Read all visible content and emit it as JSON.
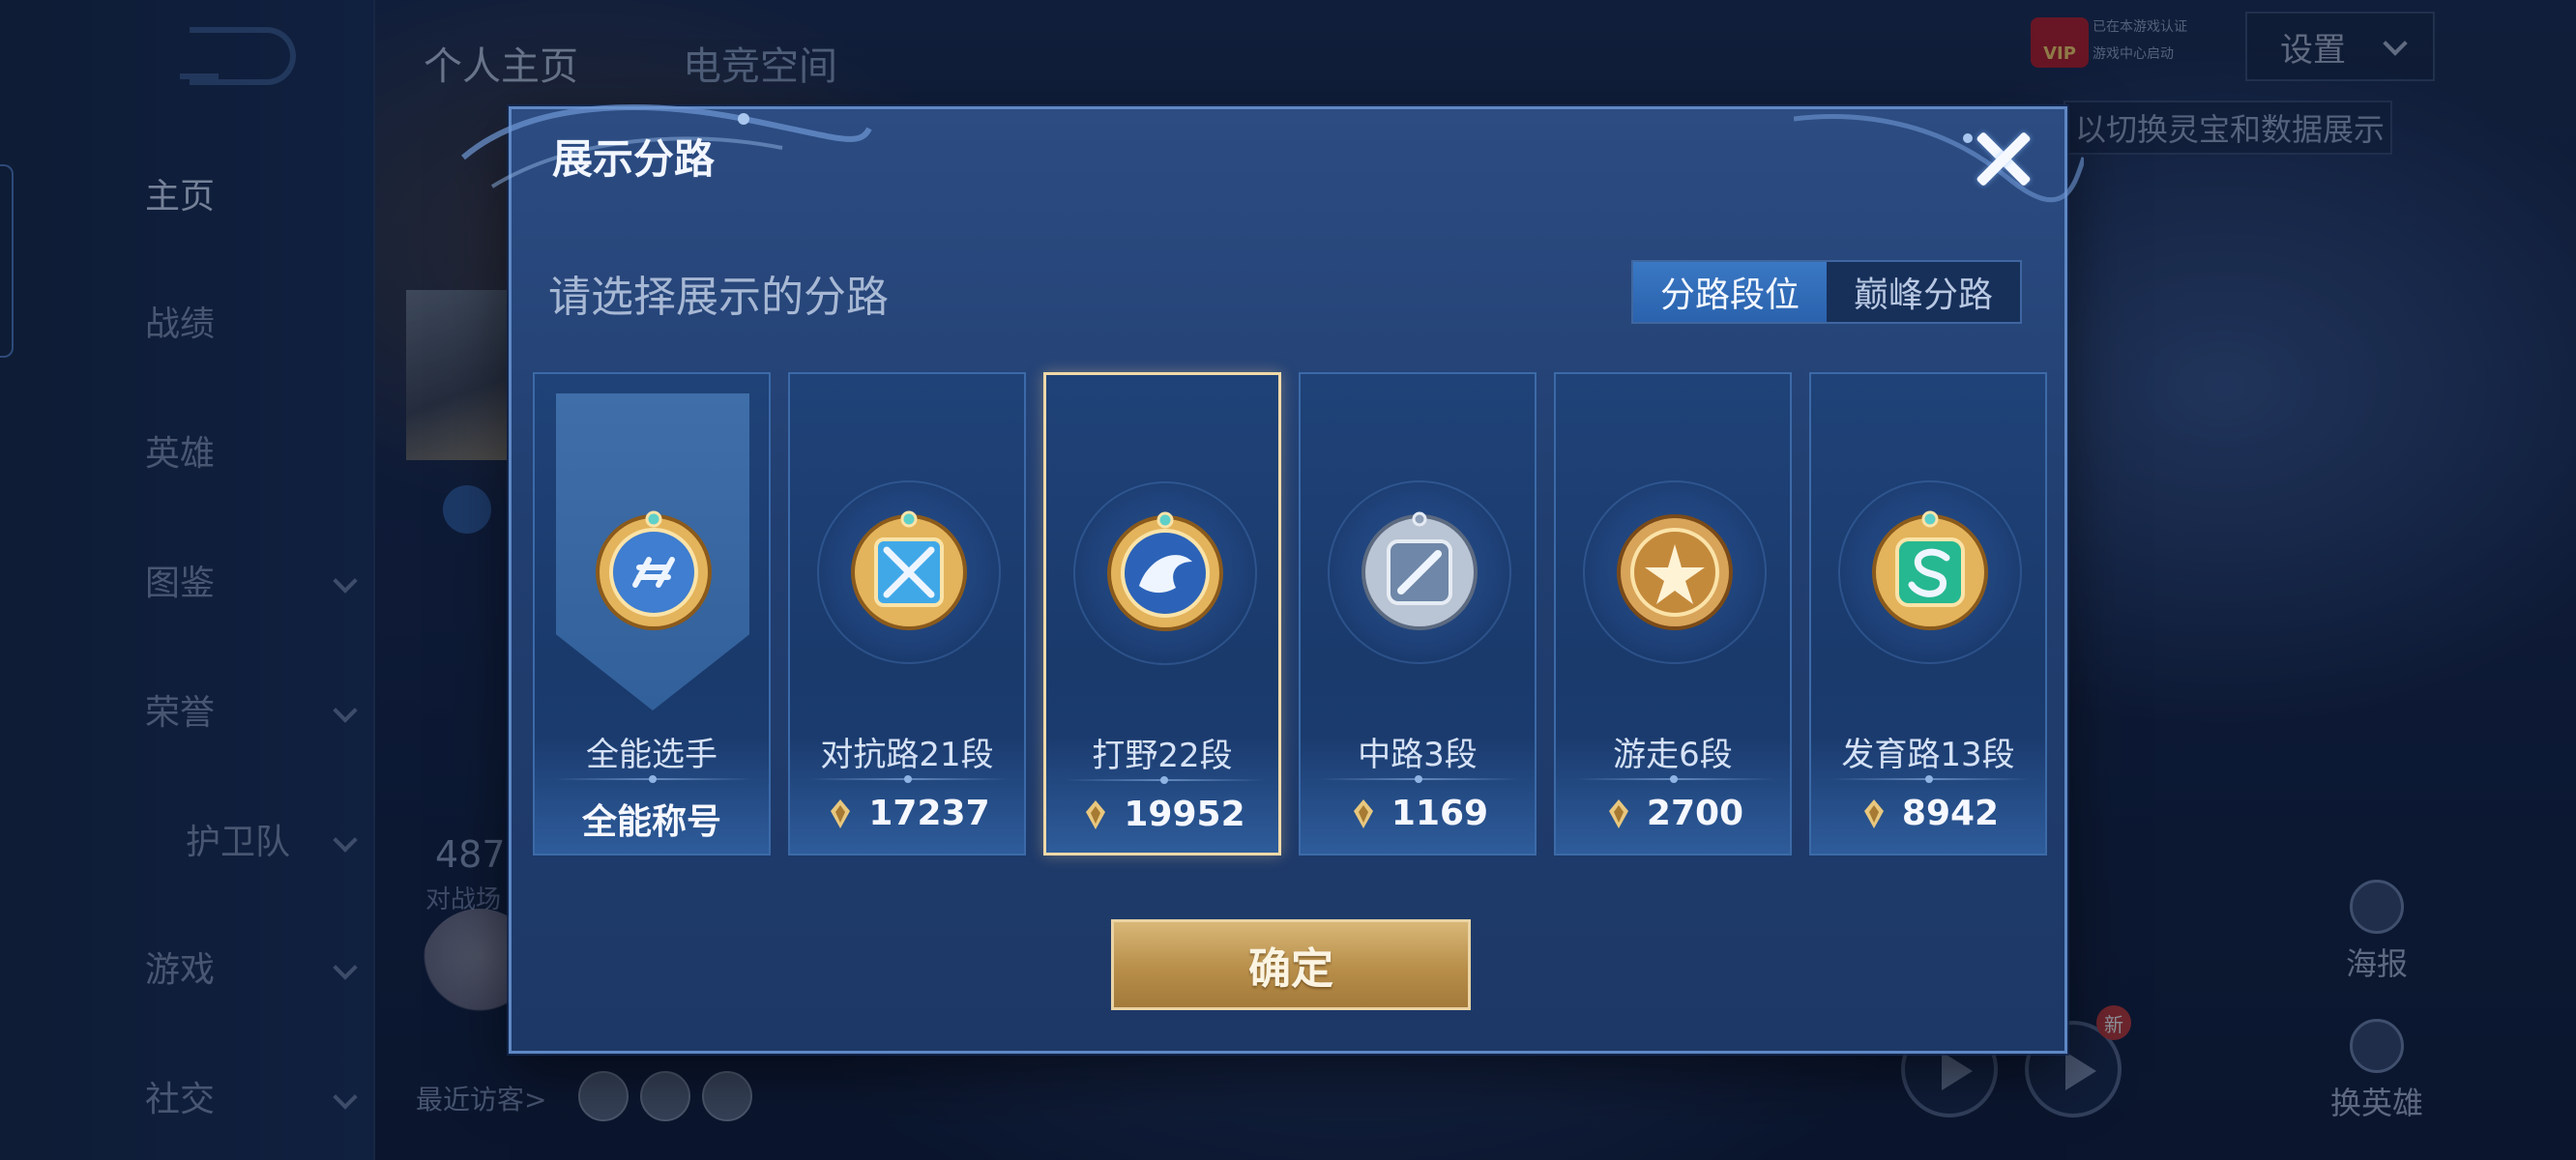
{
  "background": {
    "top_tabs": [
      "个人主页",
      "电竞空间"
    ],
    "sidebar_items": [
      {
        "label": "主页",
        "active": true,
        "expandable": false
      },
      {
        "label": "战绩",
        "active": false,
        "expandable": false
      },
      {
        "label": "英雄",
        "active": false,
        "expandable": false
      },
      {
        "label": "图鉴",
        "active": false,
        "expandable": true
      },
      {
        "label": "荣誉",
        "active": false,
        "expandable": true
      },
      {
        "label": "护卫队",
        "active": false,
        "expandable": true
      },
      {
        "label": "游戏",
        "active": false,
        "expandable": true
      },
      {
        "label": "社交",
        "active": false,
        "expandable": true
      }
    ],
    "settings_label": "设置",
    "vip_label": "VIP",
    "vip_text": [
      "已在本游戏认证",
      "游戏中心启动"
    ],
    "hint_text": "以切换灵宝和数据展示",
    "stat_value": "487",
    "stat_label": "对战场",
    "recent_visitors_label": "最近访客>",
    "side_actions": [
      "海报",
      "换英雄"
    ],
    "new_tag": "新"
  },
  "modal": {
    "title": "展示分路",
    "subtitle": "请选择展示的分路",
    "segments": [
      {
        "label": "分路段位",
        "active": true
      },
      {
        "label": "巅峰分路",
        "active": false
      }
    ],
    "cards": [
      {
        "name": "全能选手",
        "value": "全能称号",
        "has_points_icon": false,
        "selected": false,
        "emblem": "all-round-emblem-icon",
        "color": "#3f7ed0"
      },
      {
        "name": "对抗路21段",
        "value": "17237",
        "has_points_icon": true,
        "selected": false,
        "emblem": "clash-lane-emblem-icon",
        "color": "#41a8e8"
      },
      {
        "name": "打野22段",
        "value": "19952",
        "has_points_icon": true,
        "selected": true,
        "emblem": "jungle-emblem-icon",
        "color": "#2c63b8"
      },
      {
        "name": "中路3段",
        "value": "1169",
        "has_points_icon": true,
        "selected": false,
        "emblem": "mid-lane-emblem-icon",
        "color": "#6f87a8"
      },
      {
        "name": "游走6段",
        "value": "2700",
        "has_points_icon": true,
        "selected": false,
        "emblem": "roam-emblem-icon",
        "color": "#c48a3c"
      },
      {
        "name": "发育路13段",
        "value": "8942",
        "has_points_icon": true,
        "selected": false,
        "emblem": "farm-lane-emblem-icon",
        "color": "#26b891"
      }
    ],
    "confirm_label": "确定"
  }
}
